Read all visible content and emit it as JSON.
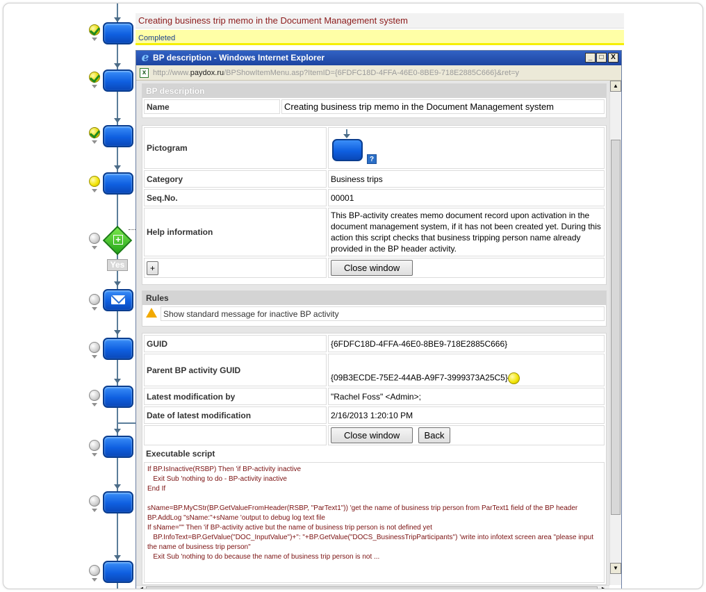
{
  "task": {
    "title": "Creating business trip memo in the Document Management system",
    "status": "Completed"
  },
  "window": {
    "title": "BP description - Windows Internet Explorer",
    "logo": "e",
    "minimize": "_",
    "maximize": "□",
    "close": "X",
    "address_prefix": "http://www.",
    "address_domain": "paydox.ru",
    "address_path": "/BPShowItemMenu.asp?ItemID={6FDFC18D-4FFA-46E0-8BE9-718E2885C666}&ret=y"
  },
  "flow": {
    "decision_label": "Yes",
    "nodes": [
      {
        "state": "done"
      },
      {
        "state": "done"
      },
      {
        "state": "done"
      },
      {
        "state": "active"
      },
      {
        "state": "wait"
      },
      {
        "state": "wait"
      },
      {
        "state": "wait"
      },
      {
        "state": "wait"
      },
      {
        "state": "wait"
      },
      {
        "state": "wait"
      }
    ]
  },
  "bp_description": {
    "header": "BP description",
    "name_label": "Name",
    "name_value": "Creating business trip memo in the Document Management system"
  },
  "details": {
    "pictogram_label": "Pictogram",
    "help_glyph": "?",
    "category_label": "Category",
    "category_value": "Business trips",
    "seq_label": "Seq.No.",
    "seq_value": "00001",
    "help_label": "Help information",
    "help_value": "This BP-activity creates memo document record upon activation in the document management system, if it has not been created yet. During this action this script checks that business tripping person name already provided in the BP header activity.",
    "expand_label": "+",
    "close_label": "Close window"
  },
  "rules": {
    "header": "Rules",
    "items": [
      "Show standard message for inactive BP activity"
    ]
  },
  "meta": {
    "guid_label": "GUID",
    "guid_value": "{6FDFC18D-4FFA-46E0-8BE9-718E2885C666}",
    "parent_label": "Parent BP activity GUID",
    "parent_value": "{09B3ECDE-75E2-44AB-A9F7-3999373A25C5}",
    "modified_by_label": "Latest modification by",
    "modified_by_value": "\"Rachel Foss\" <Admin>;",
    "modified_date_label": "Date of latest modification",
    "modified_date_value": "2/16/2013 1:20:10 PM",
    "close_label": "Close window",
    "back_label": "Back",
    "script_label": "Executable script",
    "script": "If BP.IsInactive(RSBP) Then 'if BP-activity inactive\n   Exit Sub 'nothing to do - BP-activity inactive\nEnd If\n\nsName=BP.MyCStr(BP.GetValueFromHeader(RSBP, \"ParText1\")) 'get the name of business trip person from ParText1 field of the BP header\nBP.AddLog \"sName:\"+sName 'output to debug log text file\nIf sName=\"\" Then 'if BP-activity active but the name of business trip person is not defined yet\n   BP.InfoText=BP.GetValue(\"DOC_InputValue\")+\": \"+BP.GetValue(\"DOCS_BusinessTripParticipants\") 'write into infotext screen area \"please input the name of business trip person\"\n   Exit Sub 'nothing to do because the name of business trip person is not ..."
  }
}
